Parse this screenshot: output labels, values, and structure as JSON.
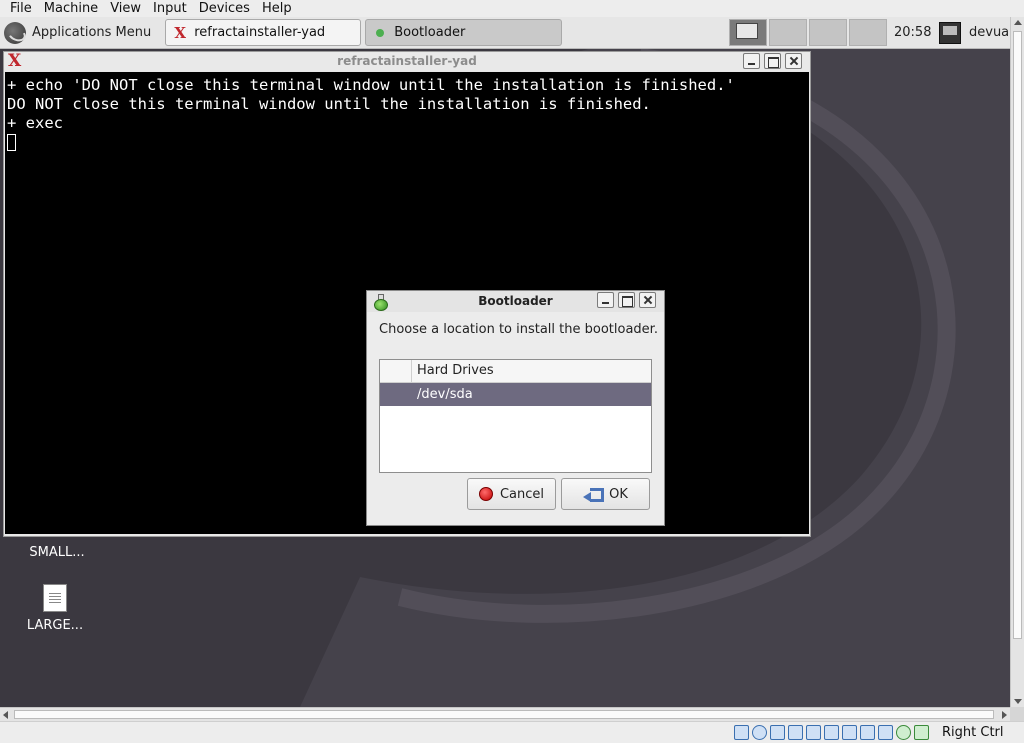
{
  "vbox_menu": [
    "File",
    "Machine",
    "View",
    "Input",
    "Devices",
    "Help"
  ],
  "panel": {
    "apps_menu_label": "Applications Menu",
    "tasks": [
      {
        "label": "refractainstaller-yad"
      },
      {
        "label": "Bootloader"
      }
    ],
    "clock": "20:58",
    "user": "devua"
  },
  "terminal": {
    "title": "refractainstaller-yad",
    "lines": [
      "+ echo 'DO NOT close this terminal window until the installation is finished.'",
      "DO NOT close this terminal window until the installation is finished.",
      "+ exec"
    ]
  },
  "desktop_icons": [
    {
      "label": "SMALL..."
    },
    {
      "label": "LARGE..."
    }
  ],
  "dialog": {
    "title": "Bootloader",
    "message": "Choose a location to install the bootloader.",
    "column_header": "Hard Drives",
    "rows": [
      "/dev/sda"
    ],
    "cancel_label": "Cancel",
    "ok_label": "OK",
    "selected_row_color": "#6e6a80"
  },
  "statusbar": {
    "host_key": "Right Ctrl"
  }
}
